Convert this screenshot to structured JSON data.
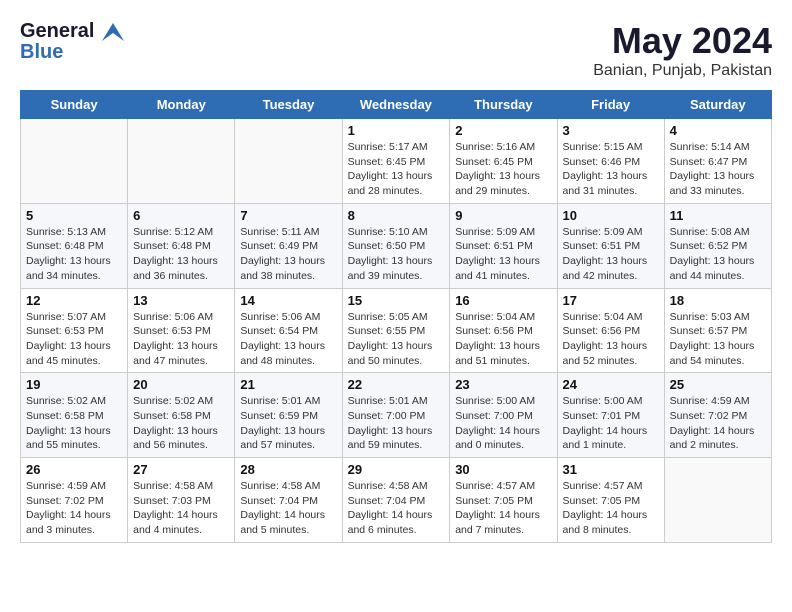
{
  "logo": {
    "line1": "General",
    "line2": "Blue"
  },
  "title": "May 2024",
  "subtitle": "Banian, Punjab, Pakistan",
  "headers": [
    "Sunday",
    "Monday",
    "Tuesday",
    "Wednesday",
    "Thursday",
    "Friday",
    "Saturday"
  ],
  "weeks": [
    [
      {
        "day": "",
        "info": ""
      },
      {
        "day": "",
        "info": ""
      },
      {
        "day": "",
        "info": ""
      },
      {
        "day": "1",
        "info": "Sunrise: 5:17 AM\nSunset: 6:45 PM\nDaylight: 13 hours\nand 28 minutes."
      },
      {
        "day": "2",
        "info": "Sunrise: 5:16 AM\nSunset: 6:45 PM\nDaylight: 13 hours\nand 29 minutes."
      },
      {
        "day": "3",
        "info": "Sunrise: 5:15 AM\nSunset: 6:46 PM\nDaylight: 13 hours\nand 31 minutes."
      },
      {
        "day": "4",
        "info": "Sunrise: 5:14 AM\nSunset: 6:47 PM\nDaylight: 13 hours\nand 33 minutes."
      }
    ],
    [
      {
        "day": "5",
        "info": "Sunrise: 5:13 AM\nSunset: 6:48 PM\nDaylight: 13 hours\nand 34 minutes."
      },
      {
        "day": "6",
        "info": "Sunrise: 5:12 AM\nSunset: 6:48 PM\nDaylight: 13 hours\nand 36 minutes."
      },
      {
        "day": "7",
        "info": "Sunrise: 5:11 AM\nSunset: 6:49 PM\nDaylight: 13 hours\nand 38 minutes."
      },
      {
        "day": "8",
        "info": "Sunrise: 5:10 AM\nSunset: 6:50 PM\nDaylight: 13 hours\nand 39 minutes."
      },
      {
        "day": "9",
        "info": "Sunrise: 5:09 AM\nSunset: 6:51 PM\nDaylight: 13 hours\nand 41 minutes."
      },
      {
        "day": "10",
        "info": "Sunrise: 5:09 AM\nSunset: 6:51 PM\nDaylight: 13 hours\nand 42 minutes."
      },
      {
        "day": "11",
        "info": "Sunrise: 5:08 AM\nSunset: 6:52 PM\nDaylight: 13 hours\nand 44 minutes."
      }
    ],
    [
      {
        "day": "12",
        "info": "Sunrise: 5:07 AM\nSunset: 6:53 PM\nDaylight: 13 hours\nand 45 minutes."
      },
      {
        "day": "13",
        "info": "Sunrise: 5:06 AM\nSunset: 6:53 PM\nDaylight: 13 hours\nand 47 minutes."
      },
      {
        "day": "14",
        "info": "Sunrise: 5:06 AM\nSunset: 6:54 PM\nDaylight: 13 hours\nand 48 minutes."
      },
      {
        "day": "15",
        "info": "Sunrise: 5:05 AM\nSunset: 6:55 PM\nDaylight: 13 hours\nand 50 minutes."
      },
      {
        "day": "16",
        "info": "Sunrise: 5:04 AM\nSunset: 6:56 PM\nDaylight: 13 hours\nand 51 minutes."
      },
      {
        "day": "17",
        "info": "Sunrise: 5:04 AM\nSunset: 6:56 PM\nDaylight: 13 hours\nand 52 minutes."
      },
      {
        "day": "18",
        "info": "Sunrise: 5:03 AM\nSunset: 6:57 PM\nDaylight: 13 hours\nand 54 minutes."
      }
    ],
    [
      {
        "day": "19",
        "info": "Sunrise: 5:02 AM\nSunset: 6:58 PM\nDaylight: 13 hours\nand 55 minutes."
      },
      {
        "day": "20",
        "info": "Sunrise: 5:02 AM\nSunset: 6:58 PM\nDaylight: 13 hours\nand 56 minutes."
      },
      {
        "day": "21",
        "info": "Sunrise: 5:01 AM\nSunset: 6:59 PM\nDaylight: 13 hours\nand 57 minutes."
      },
      {
        "day": "22",
        "info": "Sunrise: 5:01 AM\nSunset: 7:00 PM\nDaylight: 13 hours\nand 59 minutes."
      },
      {
        "day": "23",
        "info": "Sunrise: 5:00 AM\nSunset: 7:00 PM\nDaylight: 14 hours\nand 0 minutes."
      },
      {
        "day": "24",
        "info": "Sunrise: 5:00 AM\nSunset: 7:01 PM\nDaylight: 14 hours\nand 1 minute."
      },
      {
        "day": "25",
        "info": "Sunrise: 4:59 AM\nSunset: 7:02 PM\nDaylight: 14 hours\nand 2 minutes."
      }
    ],
    [
      {
        "day": "26",
        "info": "Sunrise: 4:59 AM\nSunset: 7:02 PM\nDaylight: 14 hours\nand 3 minutes."
      },
      {
        "day": "27",
        "info": "Sunrise: 4:58 AM\nSunset: 7:03 PM\nDaylight: 14 hours\nand 4 minutes."
      },
      {
        "day": "28",
        "info": "Sunrise: 4:58 AM\nSunset: 7:04 PM\nDaylight: 14 hours\nand 5 minutes."
      },
      {
        "day": "29",
        "info": "Sunrise: 4:58 AM\nSunset: 7:04 PM\nDaylight: 14 hours\nand 6 minutes."
      },
      {
        "day": "30",
        "info": "Sunrise: 4:57 AM\nSunset: 7:05 PM\nDaylight: 14 hours\nand 7 minutes."
      },
      {
        "day": "31",
        "info": "Sunrise: 4:57 AM\nSunset: 7:05 PM\nDaylight: 14 hours\nand 8 minutes."
      },
      {
        "day": "",
        "info": ""
      }
    ]
  ]
}
